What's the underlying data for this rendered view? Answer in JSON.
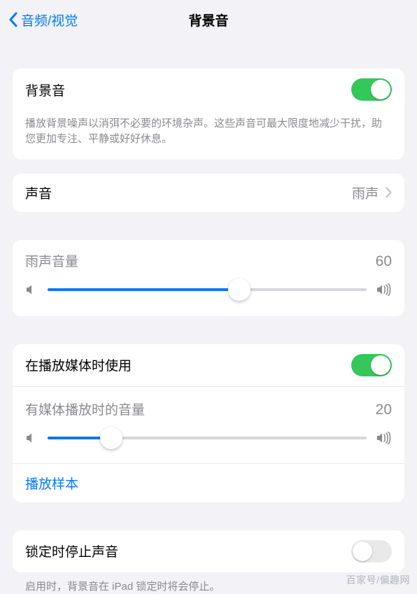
{
  "header": {
    "back_label": "音频/视觉",
    "title": "背景音"
  },
  "main_toggle": {
    "label": "背景音",
    "on": true,
    "description": "播放背景噪声以消弭不必要的环境杂声。这些声音可最大限度地减少干扰，助您更加专注、平静或好好休息。"
  },
  "sound": {
    "label": "声音",
    "value": "雨声"
  },
  "volume": {
    "label": "雨声音量",
    "value": 60,
    "percent": 60
  },
  "media": {
    "use_label": "在播放媒体时使用",
    "use_on": true,
    "media_volume_label": "有媒体播放时的音量",
    "media_volume_value": 20,
    "media_volume_percent": 20,
    "play_sample_label": "播放样本"
  },
  "lock": {
    "label": "锁定时停止声音",
    "on": false,
    "description": "启用时，背景音在 iPad 锁定时将会停止。"
  },
  "watermark": "百家号/偏趣网"
}
